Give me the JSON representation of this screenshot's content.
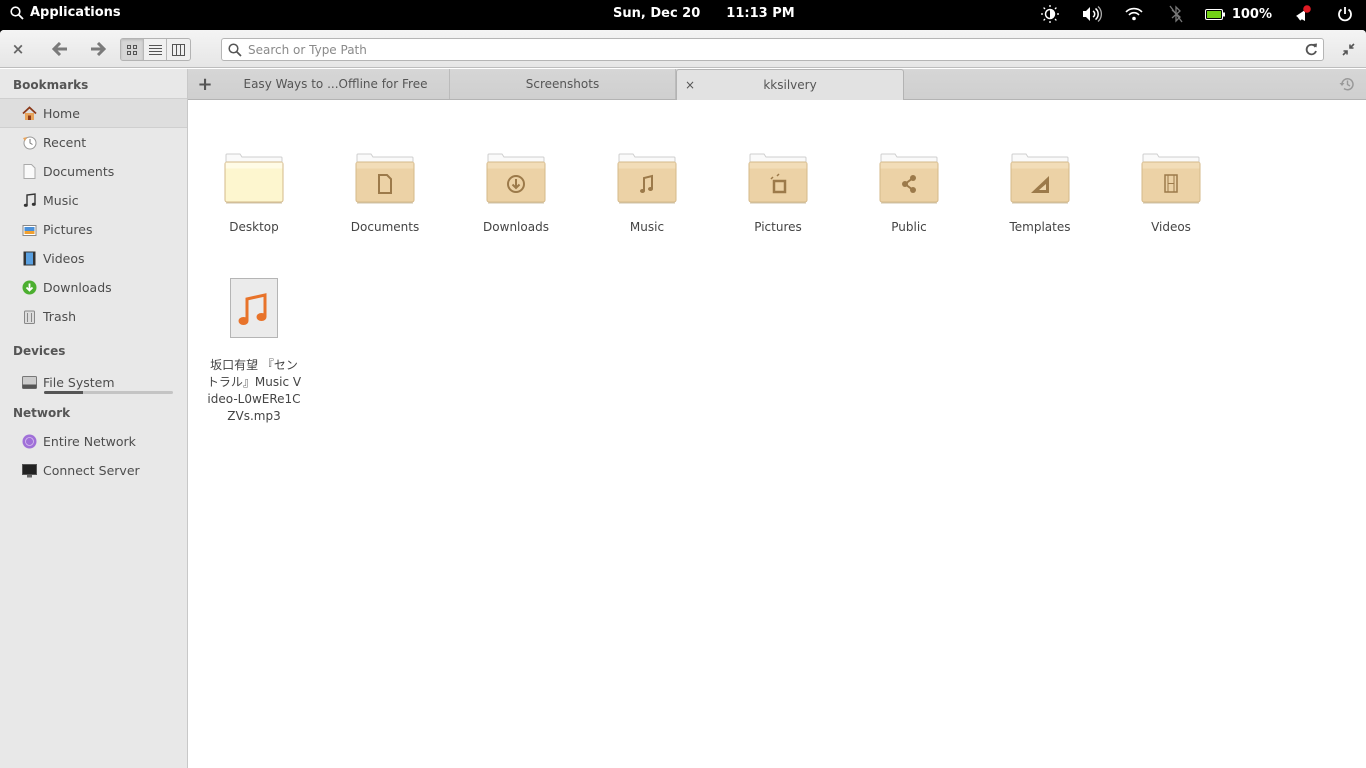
{
  "panel": {
    "applications_label": "Applications",
    "date": "Sun, Dec 20",
    "time": "11:13 PM",
    "battery_percent": "100%",
    "tray_icons": [
      "brightness-icon",
      "volume-icon",
      "wifi-icon",
      "bluetooth-off-icon",
      "battery-icon",
      "notification-icon",
      "power-icon"
    ],
    "notification_dot_color": "#e01b24",
    "battery_color": "#73d216"
  },
  "toolbar": {
    "close_label": "×",
    "back_icon": "arrow-left-icon",
    "forward_icon": "arrow-right-icon",
    "view_modes": [
      "icon-view",
      "list-view",
      "column-view"
    ],
    "active_view": "icon-view",
    "search_placeholder": "Search or Type Path",
    "search_value": ""
  },
  "sidebar": {
    "bookmarks_heading": "Bookmarks",
    "bookmarks": [
      {
        "label": "Home",
        "icon": "home-icon",
        "selected": true
      },
      {
        "label": "Recent",
        "icon": "recent-icon"
      },
      {
        "label": "Documents",
        "icon": "document-icon"
      },
      {
        "label": "Music",
        "icon": "music-icon"
      },
      {
        "label": "Pictures",
        "icon": "pictures-icon"
      },
      {
        "label": "Videos",
        "icon": "videos-icon"
      },
      {
        "label": "Downloads",
        "icon": "downloads-icon"
      },
      {
        "label": "Trash",
        "icon": "trash-icon"
      }
    ],
    "devices_heading": "Devices",
    "devices": [
      {
        "label": "File System",
        "icon": "harddisk-icon",
        "usage_fraction": 0.3
      }
    ],
    "network_heading": "Network",
    "network": [
      {
        "label": "Entire Network",
        "icon": "network-icon"
      },
      {
        "label": "Connect Server",
        "icon": "server-icon"
      }
    ]
  },
  "tabs": {
    "new_tab_label": "+",
    "items": [
      {
        "label": "Easy Ways to ...Offline for Free",
        "active": false
      },
      {
        "label": "Screenshots",
        "active": false
      },
      {
        "label": "kksilvery",
        "active": true
      }
    ],
    "close_label": "×"
  },
  "content": {
    "folders": [
      {
        "name": "Desktop",
        "emblem": "none"
      },
      {
        "name": "Documents",
        "emblem": "document"
      },
      {
        "name": "Downloads",
        "emblem": "download"
      },
      {
        "name": "Music",
        "emblem": "music"
      },
      {
        "name": "Pictures",
        "emblem": "pictures"
      },
      {
        "name": "Public",
        "emblem": "share"
      },
      {
        "name": "Templates",
        "emblem": "template"
      },
      {
        "name": "Videos",
        "emblem": "video"
      }
    ],
    "files": [
      {
        "name": "坂口有望 『セントラル』Music Video-L0wERe1CZVs.mp3",
        "type": "audio"
      }
    ]
  }
}
